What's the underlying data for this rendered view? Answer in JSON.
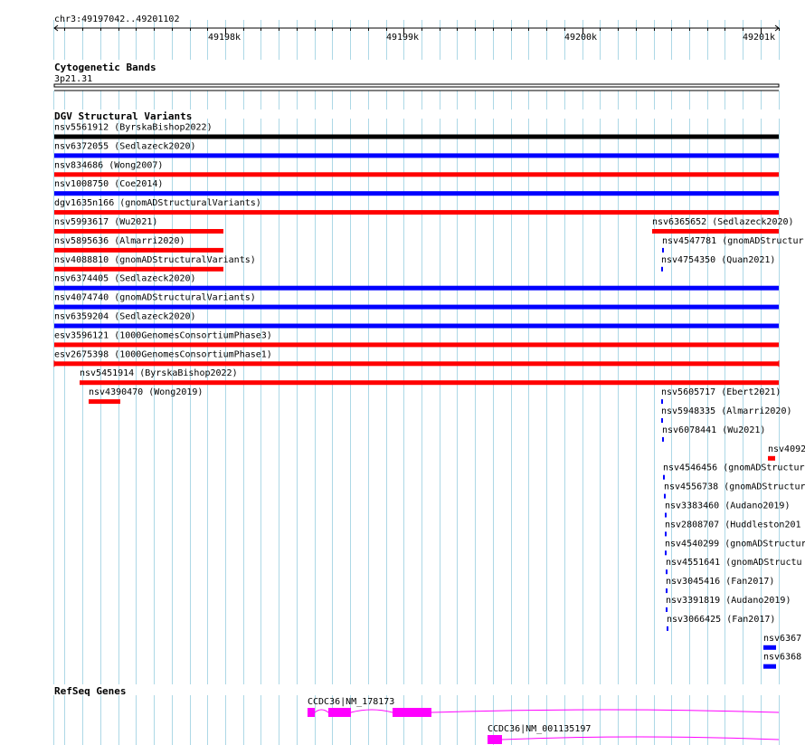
{
  "region": {
    "text": "chr3:49197042..49201102",
    "start": 49197042,
    "end": 49201102
  },
  "ruler": {
    "ticks": [
      "49198k",
      "49199k",
      "49200k",
      "49201k"
    ]
  },
  "tracks": {
    "cytoband": {
      "title": "Cytogenetic Bands",
      "band": "3p21.31"
    },
    "dgv": {
      "title": "DGV Structural Variants"
    },
    "refseq": {
      "title": "RefSeq Genes"
    }
  },
  "colors": {
    "gain": "#0000ff",
    "loss": "#ff0000",
    "complex": "#000000",
    "gene": "#ff00ff",
    "grid": "#add8e6"
  },
  "variants": [
    {
      "label": "nsv5561912 (ByrskaBishop2022)",
      "color": "#000000",
      "start": 49197042,
      "end": 49201102
    },
    {
      "label": "nsv6372055 (Sedlazeck2020)",
      "color": "#0000ff",
      "start": 49197042,
      "end": 49201102
    },
    {
      "label": "nsv834686 (Wong2007)",
      "color": "#ff0000",
      "start": 49197042,
      "end": 49201102
    },
    {
      "label": "nsv1008750 (Coe2014)",
      "color": "#0000ff",
      "start": 49197042,
      "end": 49201102
    },
    {
      "label": "dgv1635n166 (gnomADStructuralVariants)",
      "color": "#ff0000",
      "start": 49197042,
      "end": 49201102
    },
    {
      "label": "nsv5993617 (Wu2021)",
      "color": "#ff0000",
      "start": 49197042,
      "end": 49197990
    },
    {
      "label": "nsv6365652 (Sedlazeck2020)",
      "color": "#ff0000",
      "start": 49200392,
      "end": 49201102
    },
    {
      "label": "nsv5895636 (Almarri2020)",
      "color": "#ff0000",
      "start": 49197042,
      "end": 49197990
    },
    {
      "label": "nsv4547781 (gnomADStructur",
      "color": "#0000ff",
      "start": 49200447,
      "end": 49200457
    },
    {
      "label": "nsv4088810 (gnomADStructuralVariants)",
      "color": "#ff0000",
      "start": 49197042,
      "end": 49197990
    },
    {
      "label": "nsv4754350 (Quan2021)",
      "color": "#0000ff",
      "start": 49200442,
      "end": 49200452
    },
    {
      "label": "nsv6374405 (Sedlazeck2020)",
      "color": "#0000ff",
      "start": 49197042,
      "end": 49201102
    },
    {
      "label": "nsv4074740 (gnomADStructuralVariants)",
      "color": "#0000ff",
      "start": 49197042,
      "end": 49201102
    },
    {
      "label": "nsv6359204 (Sedlazeck2020)",
      "color": "#0000ff",
      "start": 49197042,
      "end": 49201102
    },
    {
      "label": "esv3596121 (1000GenomesConsortiumPhase3)",
      "color": "#ff0000",
      "start": 49197042,
      "end": 49201102
    },
    {
      "label": "esv2675398 (1000GenomesConsortiumPhase1)",
      "color": "#ff0000",
      "start": 49197042,
      "end": 49201102
    },
    {
      "label": "nsv5451914 (ByrskaBishop2022)",
      "color": "#ff0000",
      "start": 49197182,
      "end": 49201102
    },
    {
      "label": "nsv4390470 (Wong2019)",
      "color": "#ff0000",
      "start": 49197237,
      "end": 49197412
    },
    {
      "label": "nsv5605717 (Ebert2021)",
      "color": "#0000ff",
      "start": 49200442,
      "end": 49200452
    },
    {
      "label": "nsv5948335 (Almarri2020)",
      "color": "#0000ff",
      "start": 49200442,
      "end": 49200452
    },
    {
      "label": "nsv6078441 (Wu2021)",
      "color": "#0000ff",
      "start": 49200447,
      "end": 49200457
    },
    {
      "label": "nsv4092",
      "color": "#ff0000",
      "start": 49201042,
      "end": 49201082
    },
    {
      "label": "nsv4546456 (gnomADStructur",
      "color": "#0000ff",
      "start": 49200452,
      "end": 49200462
    },
    {
      "label": "nsv4556738 (gnomADStructur",
      "color": "#0000ff",
      "start": 49200457,
      "end": 49200467
    },
    {
      "label": "nsv3383460 (Audano2019)",
      "color": "#0000ff",
      "start": 49200462,
      "end": 49200472
    },
    {
      "label": "nsv2808707 (Huddleston201",
      "color": "#0000ff",
      "start": 49200462,
      "end": 49200472
    },
    {
      "label": "nsv4540299 (gnomADStructur",
      "color": "#0000ff",
      "start": 49200462,
      "end": 49200472
    },
    {
      "label": "nsv4551641 (gnomADStructu",
      "color": "#0000ff",
      "start": 49200467,
      "end": 49200477
    },
    {
      "label": "nsv3045416 (Fan2017)",
      "color": "#0000ff",
      "start": 49200467,
      "end": 49200477
    },
    {
      "label": "nsv3391819 (Audano2019)",
      "color": "#0000ff",
      "start": 49200467,
      "end": 49200477
    },
    {
      "label": "nsv3066425 (Fan2017)",
      "color": "#0000ff",
      "start": 49200472,
      "end": 49200482
    },
    {
      "label": "nsv6367",
      "color": "#0000ff",
      "start": 49201017,
      "end": 49201087
    },
    {
      "label": "nsv6368",
      "color": "#0000ff",
      "start": 49201017,
      "end": 49201087
    }
  ],
  "genes": [
    {
      "label": "CCDC36|NM_178173",
      "start": 49198462,
      "end": 49201102,
      "exons": [
        [
          49198462,
          49198502
        ],
        [
          49198577,
          49198702
        ],
        [
          49198937,
          49199157
        ]
      ]
    },
    {
      "label": "CCDC36|NM_001135197",
      "start": 49199472,
      "end": 49201102,
      "exons": [
        [
          49199472,
          49199552
        ]
      ]
    }
  ]
}
